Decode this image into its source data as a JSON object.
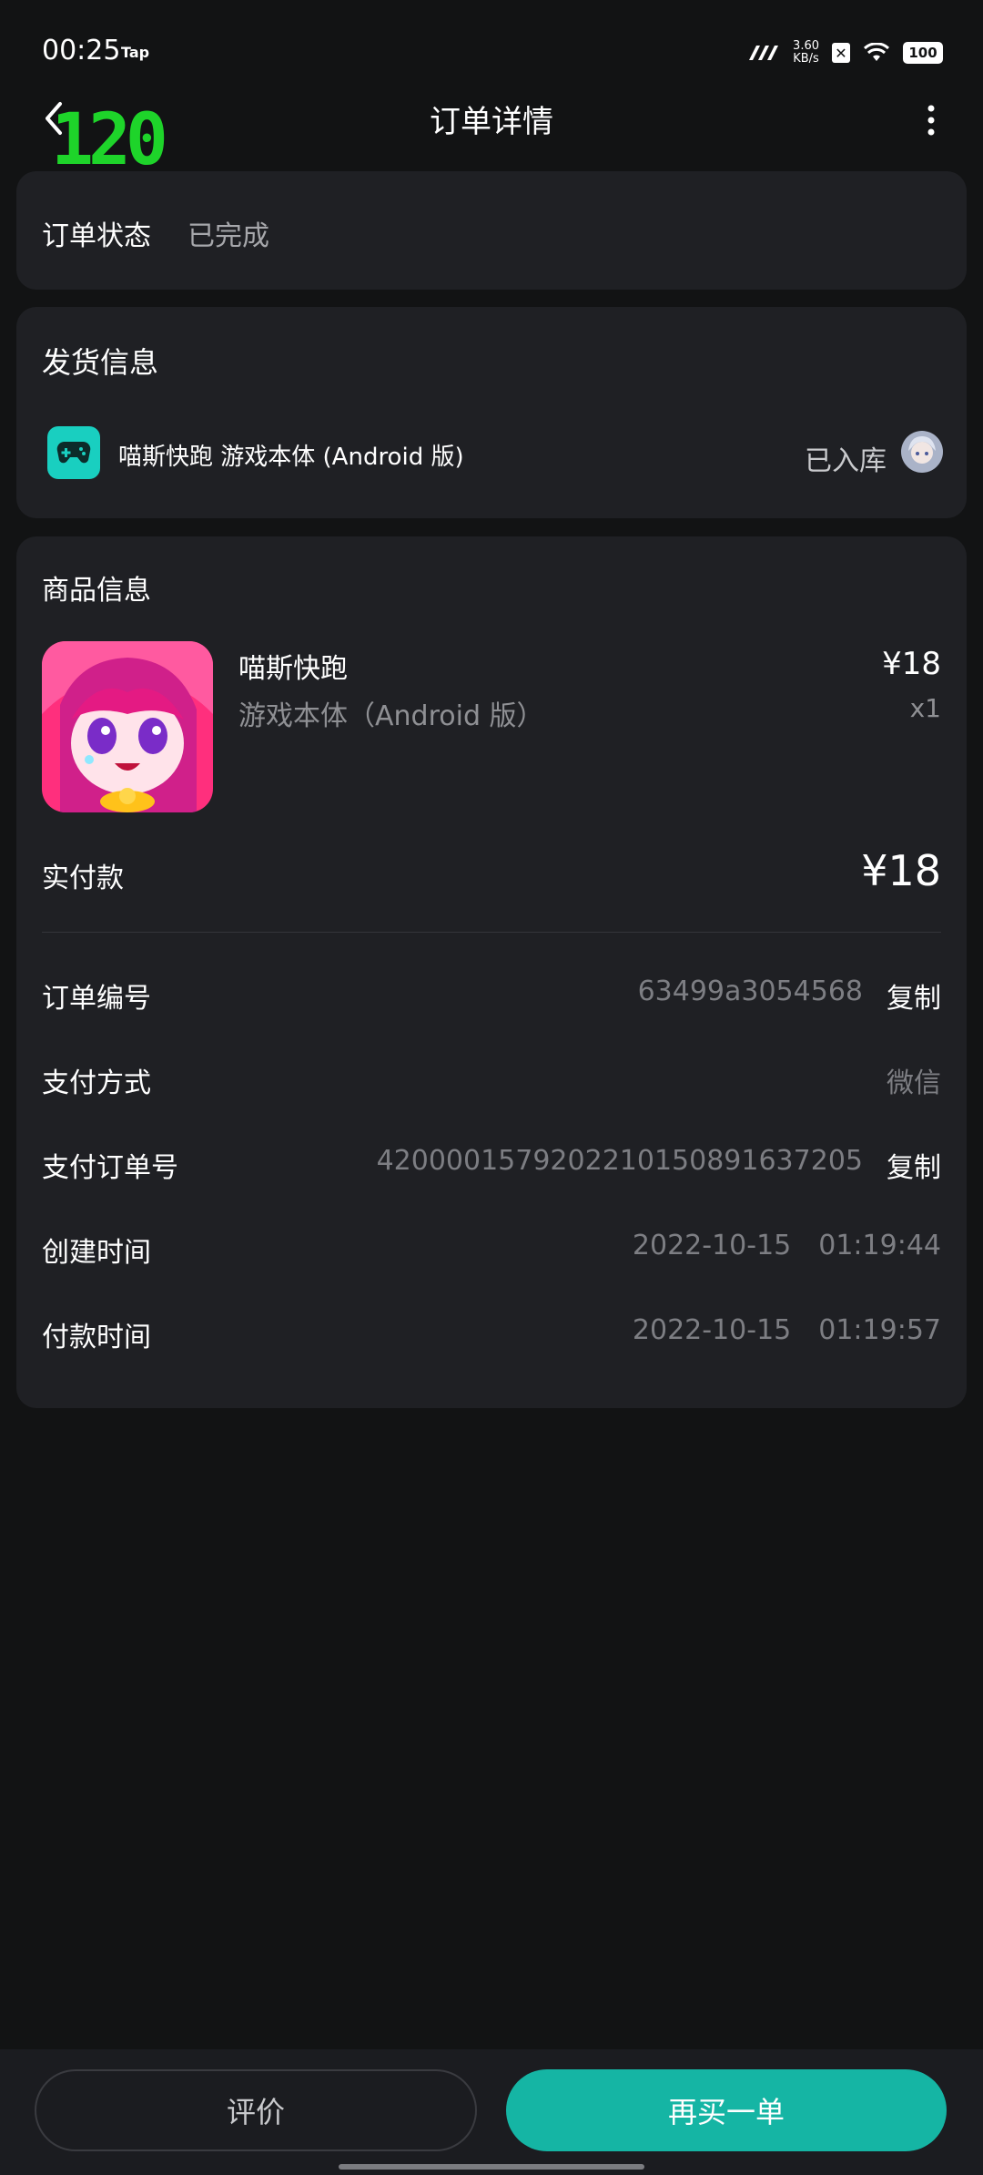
{
  "status_bar": {
    "time": "00:25",
    "app_badge": "Tap",
    "speed_value": "3.60",
    "speed_unit": "KB/s",
    "battery": "100"
  },
  "header": {
    "fps_overlay": "120",
    "title": "订单详情"
  },
  "order_status": {
    "label": "订单状态",
    "value": "已完成"
  },
  "shipping": {
    "title": "发货信息",
    "item_name": "喵斯快跑 游戏本体 (Android 版)",
    "status": "已入库"
  },
  "product": {
    "title": "商品信息",
    "name": "喵斯快跑",
    "sku": "游戏本体（Android 版）",
    "price": "¥18",
    "quantity": "x1",
    "paid_label": "实付款",
    "paid_amount": "¥18"
  },
  "details": {
    "order_no_label": "订单编号",
    "order_no": "63499a3054568",
    "copy_label": "复制",
    "pay_method_label": "支付方式",
    "pay_method": "微信",
    "pay_order_no_label": "支付订单号",
    "pay_order_no": "4200001579202210150891637205",
    "created_label": "创建时间",
    "created_date": "2022-10-15",
    "created_time": "01:19:44",
    "paid_time_label": "付款时间",
    "paid_date": "2022-10-15",
    "paid_time": "01:19:57"
  },
  "actions": {
    "review": "评价",
    "rebuy": "再买一单"
  },
  "colors": {
    "background": "#121314",
    "card": "#1f2024",
    "accent": "#15b5a4",
    "game_icon": "#19cfc0",
    "fps_green": "#1ed42a"
  }
}
